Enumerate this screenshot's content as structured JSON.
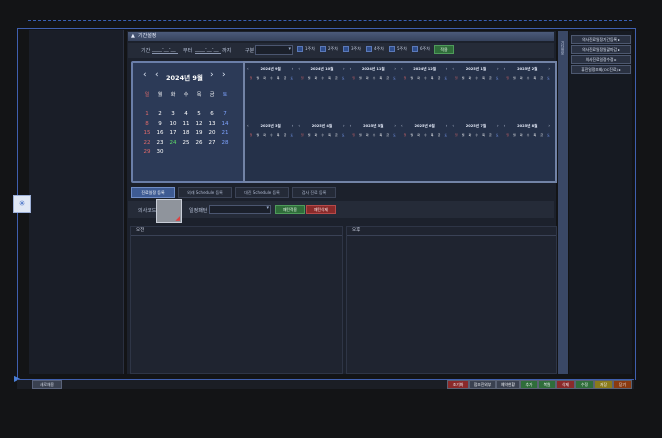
{
  "window": {
    "left_handle_icon": "pin-icon"
  },
  "section": {
    "title": "기간설정"
  },
  "filter": {
    "period_label": "기간",
    "from_value": "____-__-__",
    "from_suffix": "부터",
    "to_value": "____-__-__",
    "to_suffix": "까지",
    "type_label": "구분",
    "type_value": "",
    "weeks": [
      "1주차",
      "2주차",
      "3주차",
      "4주차",
      "5주차",
      "6주차"
    ],
    "apply_label": "적용"
  },
  "calendar": {
    "month_title": "2024년 9월",
    "weekdays": [
      "일",
      "월",
      "화",
      "수",
      "목",
      "금",
      "토"
    ],
    "weeks": [
      [
        "1",
        "2",
        "3",
        "4",
        "5",
        "6",
        "7"
      ],
      [
        "8",
        "9",
        "10",
        "11",
        "12",
        "13",
        "14"
      ],
      [
        "15",
        "16",
        "17",
        "18",
        "19",
        "20",
        "21"
      ],
      [
        "22",
        "23",
        "24",
        "25",
        "26",
        "27",
        "28"
      ],
      [
        "29",
        "30",
        "",
        "",
        "",
        "",
        ""
      ]
    ],
    "today": "24"
  },
  "mini_calendars": [
    "2024년 9월",
    "2024년 10월",
    "2024년 11월",
    "2024년 12월",
    "2025년 1월",
    "2025년 2월",
    "2025년 3월",
    "2025년 4월",
    "2025년 5월",
    "2025년 6월",
    "2025년 7월",
    "2025년 8월"
  ],
  "tabs": [
    "진료일정 등록",
    "외래 Schedule 등록",
    "대진 Schedule 등록",
    "검사 진료 등록"
  ],
  "doctor": {
    "label": "의사코드",
    "schedule_label": "일정패턴",
    "schedule_value": "",
    "add_label": "패턴적용",
    "del_label": "패턴삭제"
  },
  "panels": {
    "am": "오전",
    "pm": "오후"
  },
  "right_buttons": [
    "의사진료일정기간등록",
    "의사진료일정일괄마감",
    "의사진료일정수정",
    "휴진일정조회(OC진료)"
  ],
  "right_side_label": "기타정보",
  "bottom": {
    "left_label": "새로채용",
    "buttons": [
      {
        "label": "조기화",
        "color": "#8a2a2a"
      },
      {
        "label": "접조진외부",
        "color": "#3a4150"
      },
      {
        "label": "예약현황",
        "color": "#3a4150"
      },
      {
        "label": "추가",
        "color": "#2f6d3a"
      },
      {
        "label": "복원",
        "color": "#2f6d3a"
      },
      {
        "label": "삭제",
        "color": "#8a2a2a"
      },
      {
        "label": "수정",
        "color": "#2f6d3a"
      },
      {
        "label": "저장",
        "color": "#8a7a1a"
      },
      {
        "label": "닫기",
        "color": "#8a3a10"
      }
    ]
  }
}
